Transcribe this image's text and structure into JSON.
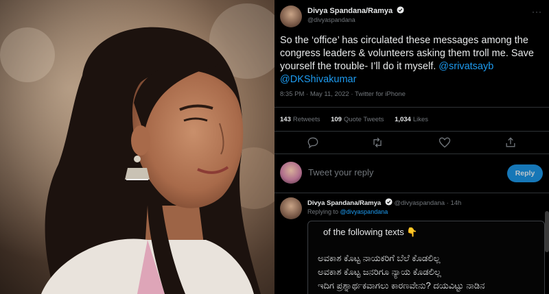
{
  "photo": {
    "alt": ""
  },
  "tweet": {
    "author_name": "Divya Spandana/Ramya",
    "author_handle": "@divyaspandana",
    "text_before": "So the ‘office’ has circulated these messages among the congress leaders & volunteers asking them troll me. Save yourself the trouble- I’ll do it myself. ",
    "mention_1": "@srivatsayb",
    "mention_2": "@DKShivakumar",
    "meta": "8:35 PM · May 11, 2022 · Twitter for iPhone",
    "stats": {
      "retweets_count": "143",
      "retweets_label": "Retweets",
      "quotes_count": "109",
      "quotes_label": "Quote Tweets",
      "likes_count": "1,034",
      "likes_label": "Likes"
    },
    "icons": [
      "reply-icon",
      "retweet-icon",
      "like-icon",
      "share-icon"
    ]
  },
  "reply_box": {
    "placeholder": "Tweet your reply",
    "button_label": "Reply"
  },
  "thread_reply": {
    "author_name": "Divya Spandana/Ramya",
    "author_handle": "@divyaspandana · 14h",
    "replying_prefix": "Replying to ",
    "replying_to": "@divyaspandana",
    "embed_lines": [
      "of the following texts 👇",
      "ಅವಕಾಶ ಕೊಟ್ಟ ನಾಯಕರಿಗೆ ಬೆಲೆ ಕೊಡಲಿಲ್ಲ",
      "ಅವಕಾಶ ಕೊಟ್ಟ ಜನರಿಗೂ ನ್ಯಾಯ ಕೊಡಲಿಲ್ಲ",
      "ಇದಿಗ ಪ್ರಶ್ನಾರ್ಥಕವಾಗಲು ಕಾರಣವೇನು? ದಯವಿಟ್ಟು ನಾಡಿನ"
    ]
  },
  "colors": {
    "background": "#000000",
    "accent": "#1d9bf0",
    "muted": "#71767b",
    "text": "#e7e9ea"
  }
}
